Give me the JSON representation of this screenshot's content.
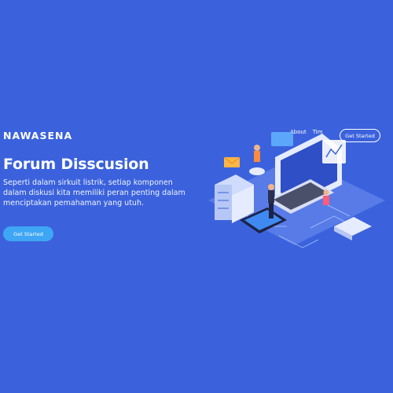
{
  "brand": "NAWASENA",
  "nav": {
    "links": [
      "About",
      "Tim"
    ],
    "cta": "Get Started"
  },
  "hero": {
    "title": "Forum Disscusion",
    "description": "Seperti dalam sirkuit listrik, setiap komponen dalam diskusi kita memiliki peran penting dalam menciptakan pemahaman yang utuh.",
    "cta": "Get Started"
  },
  "illustration": {
    "icons": [
      "isometric-laptop",
      "server-stack",
      "smartphone",
      "mail-icon",
      "person-figure"
    ],
    "colors": {
      "background": "#3b62dc",
      "accent": "#3ea6f4",
      "platform": "#6f8ff0"
    }
  }
}
